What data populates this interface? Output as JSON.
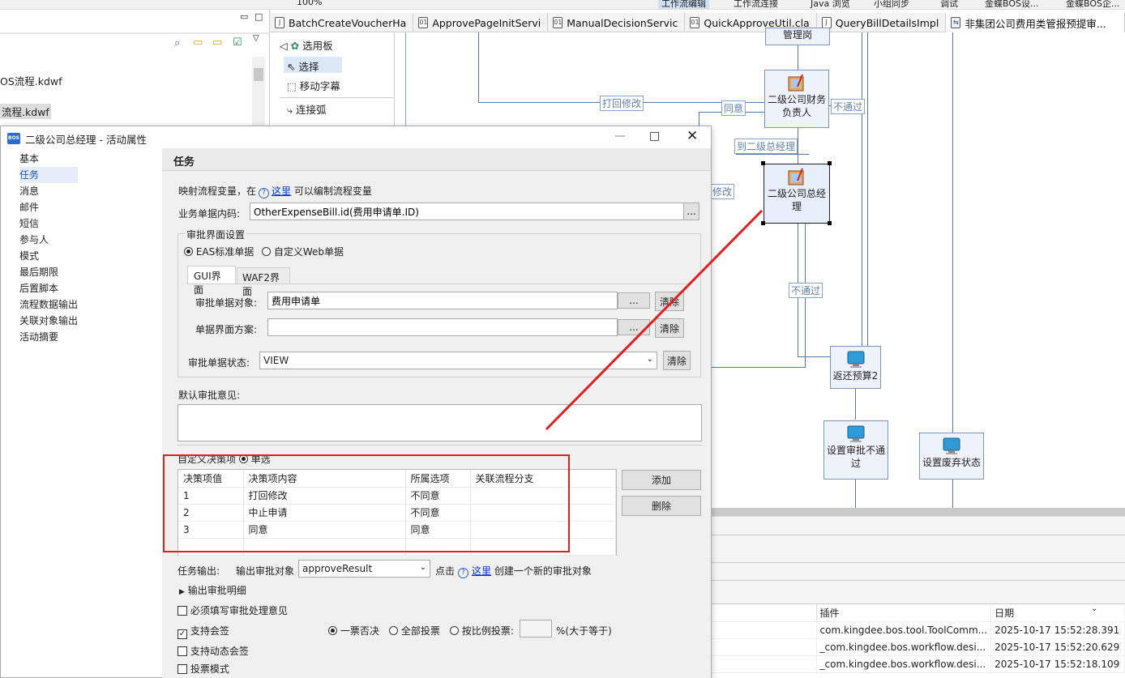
{
  "toolbar": {
    "zoom": "100%",
    "right_items": [
      "工作流编辑",
      "工作流连接",
      "Java 浏览",
      "小组同步",
      "调试",
      "金蝶BOS设...",
      "金蝶BOS企..."
    ]
  },
  "editor_tabs": [
    "BatchCreateVoucherHa",
    "ApprovePageInitServi",
    "ManualDecisionServic",
    "QuickApproveUtil.cla",
    "QueryBillDetailsImpl",
    "非集团公司费用类管报预提审..."
  ],
  "left_tree": [
    "OS流程.kdwf",
    "流程.kdwf"
  ],
  "palette": {
    "header": "选用板",
    "items": [
      "选择",
      "移动字幕",
      "连接弧"
    ]
  },
  "diagram": {
    "nodes": [
      "管理岗",
      "二级公司财务负责人",
      "二级公司总经理",
      "返还预算2",
      "设置审批不通过",
      "设置废弃状态"
    ],
    "edge_labels": [
      "打回修改",
      "同意",
      "不通过",
      "到二级总经理",
      "修改",
      "不通过"
    ]
  },
  "dialog": {
    "title": "二级公司总经理 - 活动属性",
    "nav": [
      "基本",
      "任务",
      "消息",
      "邮件",
      "短信",
      "参与人",
      "模式",
      "最后期限",
      "后置脚本",
      "流程数据输出",
      "关联对象输出",
      "活动摘要"
    ],
    "panel_title": "任务",
    "map_vars_prefix": "映射流程变量，在",
    "here_link": "这里",
    "map_vars_suffix": "可以编制流程变量",
    "bill_code_label": "业务单据内码:",
    "bill_code_value": "OtherExpenseBill.id(费用申请单.ID)",
    "approve_ui_group": "审批界面设置",
    "radio_eas": "EAS标准单据",
    "radio_web": "自定义Web单据",
    "subtab_gui": "GUI界面",
    "subtab_waf": "WAF2界面",
    "approve_obj_label": "审批单据对象:",
    "approve_obj_value": "费用申请单",
    "bill_ui_label": "单据界面方案:",
    "bill_ui_value": "",
    "bill_state_label": "审批单据状态:",
    "bill_state_value": "VIEW",
    "clear": "清除",
    "browse": "...",
    "default_opinion_label": "默认审批意见:",
    "default_opinion_value": "",
    "decision_label": "自定义决策项",
    "single_choice": "单选",
    "decision_columns": [
      "决策项值",
      "决策项内容",
      "所属选项",
      "关联流程分支"
    ],
    "decision_rows": [
      [
        "1",
        "打回修改",
        "不同意",
        ""
      ],
      [
        "2",
        "中止申请",
        "不同意",
        ""
      ],
      [
        "3",
        "同意",
        "同意",
        ""
      ]
    ],
    "add_button": "添加",
    "delete_button": "删除",
    "task_output_label": "任务输出:",
    "output_obj_label": "输出审批对象",
    "output_obj_value": "approveResult",
    "click_text": "点击",
    "create_text": "创建一个新的审批对象",
    "output_detail": "输出审批明细",
    "must_fill": "必须填写审批处理意见",
    "support_countersign": "支持会签",
    "radio_one_veto": "一票否决",
    "radio_all_vote": "全部投票",
    "radio_ratio": "按比例投票:",
    "ratio_value": "",
    "ratio_suffix": "%(大于等于)",
    "support_dynamic": "支持动态会签",
    "vote_mode": "投票模式"
  },
  "log": {
    "columns": [
      "插件",
      "日期"
    ],
    "rows": [
      [
        "com.kingdee.bos.tool.ToolComm...",
        "2025-10-17 15:52:28.391"
      ],
      [
        "_com.kingdee.bos.workflow.desi...",
        "2025-10-17 15:52:20.629"
      ],
      [
        "_com.kingdee.bos.workflow.desi...",
        "2025-10-17 15:52:18.109"
      ]
    ]
  },
  "colors": {
    "annotation": "#e02020",
    "link": "#0033cc",
    "node_border": "#7d95b8"
  }
}
